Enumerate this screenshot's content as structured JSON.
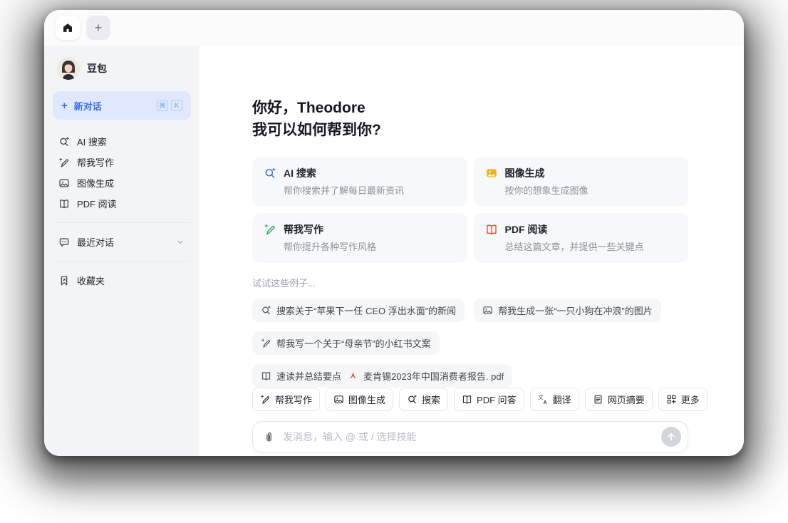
{
  "colors": {
    "accent_blue": "#3a6ef0",
    "card_icon_yellow": "#e9b41c",
    "card_icon_green": "#2fae5d",
    "card_icon_red": "#e5503b",
    "pdf_file_red": "#e2452c",
    "new_chat_bg": "#dfe8fd",
    "sidebar_bg": "#f3f4f6",
    "card_bg": "#f7f8fa",
    "chip_bg": "#f5f6f7"
  },
  "tabbar": {
    "new_tab_label": "+"
  },
  "sidebar": {
    "profile": {
      "name": "豆包"
    },
    "new_chat": {
      "label": "新对话",
      "shortcut": [
        "⌘",
        "K"
      ]
    },
    "items": [
      {
        "label": "AI 搜索"
      },
      {
        "label": "帮我写作"
      },
      {
        "label": "图像生成"
      },
      {
        "label": "PDF 阅读"
      }
    ],
    "recent": {
      "label": "最近对话"
    },
    "favorites": {
      "label": "收藏夹"
    }
  },
  "main": {
    "greeting_line1": "你好，Theodore",
    "greeting_line2": "我可以如何帮到你?",
    "cards": [
      {
        "title": "AI 搜索",
        "subtitle": "帮你搜索并了解每日最新资讯"
      },
      {
        "title": "图像生成",
        "subtitle": "按你的想象生成图像"
      },
      {
        "title": "帮我写作",
        "subtitle": "帮你提升各种写作风格"
      },
      {
        "title": "PDF 阅读",
        "subtitle": "总结这篇文章，并提供一些关键点"
      }
    ],
    "examples_label": "试试这些例子...",
    "example_chips": [
      {
        "label": "搜索关于“苹果下一任 CEO 浮出水面”的新闻"
      },
      {
        "label": "帮我生成一张“一只小狗在冲浪”的图片"
      },
      {
        "label": "帮我写一个关于“母亲节”的小红书文案"
      },
      {
        "label": "速读并总结要点",
        "attachment": "麦肯锡2023年中国消费者报告. pdf"
      }
    ],
    "toolbar_chips": [
      {
        "label": "帮我写作"
      },
      {
        "label": "图像生成"
      },
      {
        "label": "搜索"
      },
      {
        "label": "PDF 问答"
      },
      {
        "label": "翻译"
      },
      {
        "label": "网页摘要"
      },
      {
        "label": "更多"
      }
    ],
    "input": {
      "placeholder": "发消息，输入 @ 或 / 选择技能"
    }
  }
}
